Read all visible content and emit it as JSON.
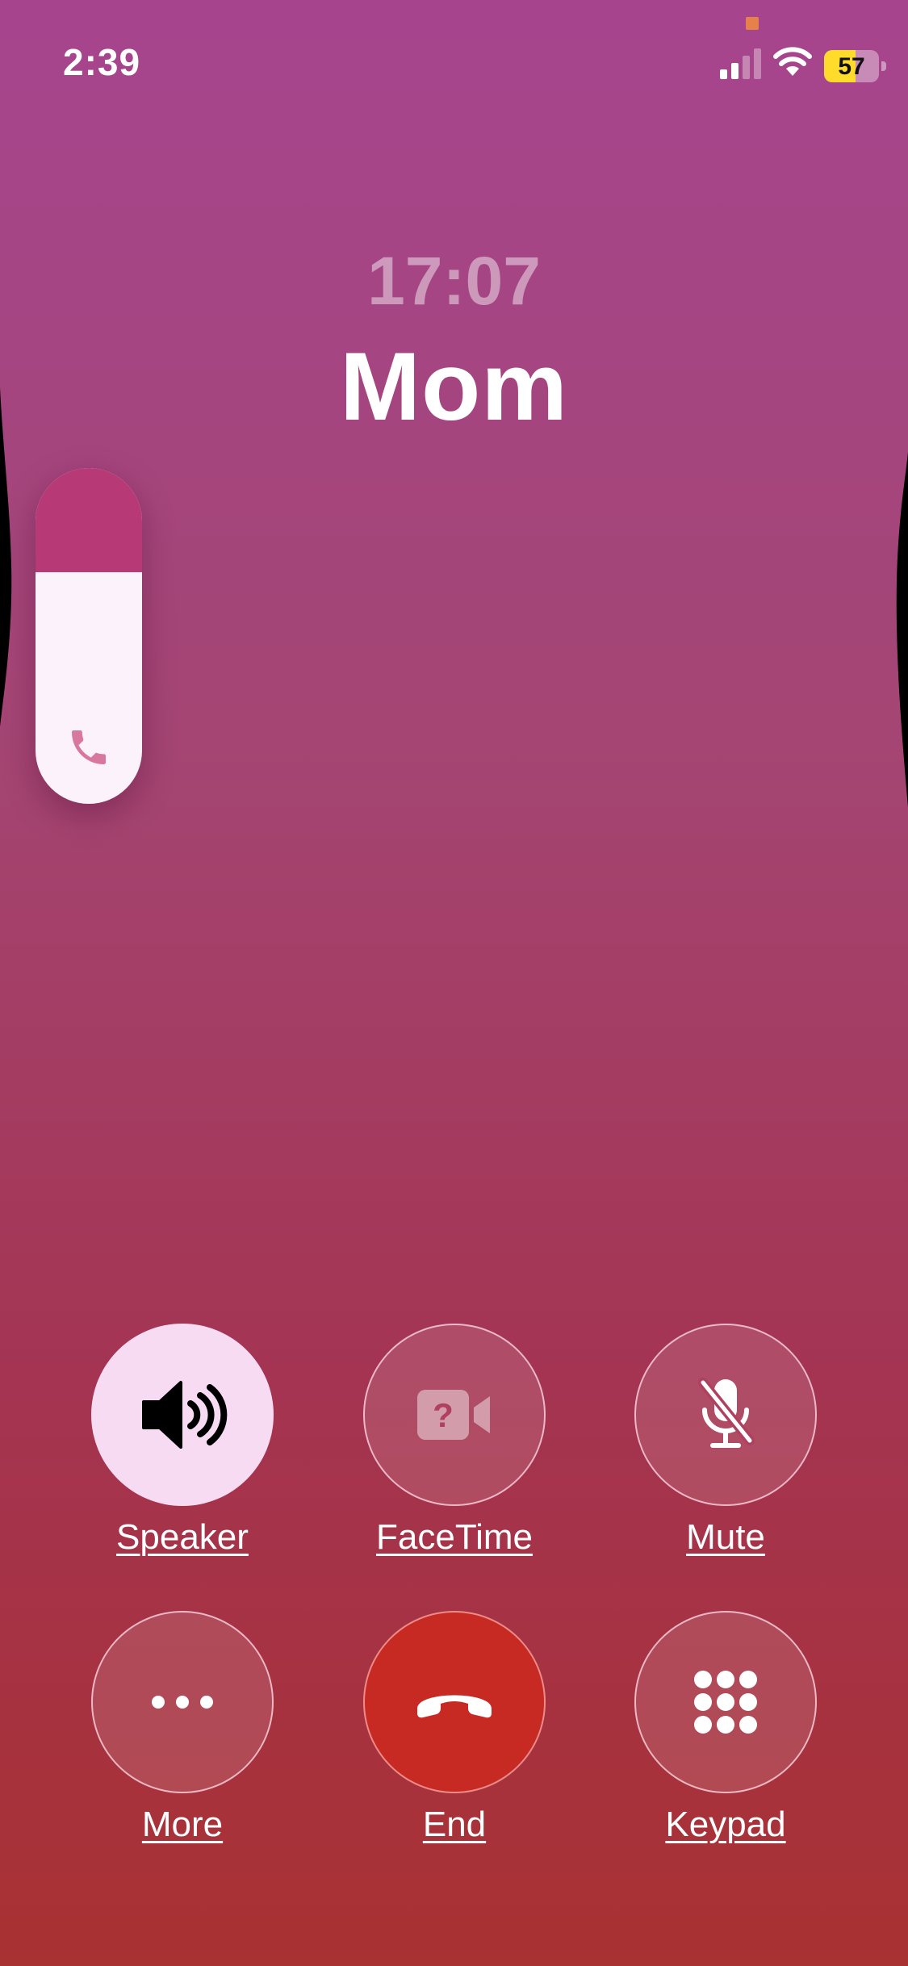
{
  "status_bar": {
    "time": "2:39",
    "battery_level": "57",
    "battery_fraction": 0.57,
    "signal_bars_active": 2,
    "signal_bars_total": 4,
    "signal_icon": "cellular-signal-icon",
    "wifi_icon": "wifi-icon",
    "privacy_indicator_color": "#e6814b"
  },
  "call": {
    "duration": "17:07",
    "caller_name": "Mom"
  },
  "volume_hud": {
    "level": 0.69,
    "icon": "phone-icon",
    "fill_color": "#fcf2fb",
    "empty_color": "#b73a76"
  },
  "controls": {
    "speaker": {
      "label": "Speaker",
      "icon": "speaker-wave-icon",
      "active": true
    },
    "facetime": {
      "label": "FaceTime",
      "icon": "video-question-icon",
      "active": false
    },
    "mute": {
      "label": "Mute",
      "icon": "mic-slash-icon",
      "active": false
    },
    "more": {
      "label": "More",
      "icon": "ellipsis-icon",
      "active": false
    },
    "end": {
      "label": "End",
      "icon": "phone-down-icon",
      "color": "#c62a22"
    },
    "keypad": {
      "label": "Keypad",
      "icon": "keypad-grid-icon",
      "active": false
    }
  },
  "theme": {
    "gradient_top": "#a6458e",
    "gradient_bottom": "#a83132",
    "end_call_red": "#c62a22",
    "active_button": "#f7dbf2"
  }
}
